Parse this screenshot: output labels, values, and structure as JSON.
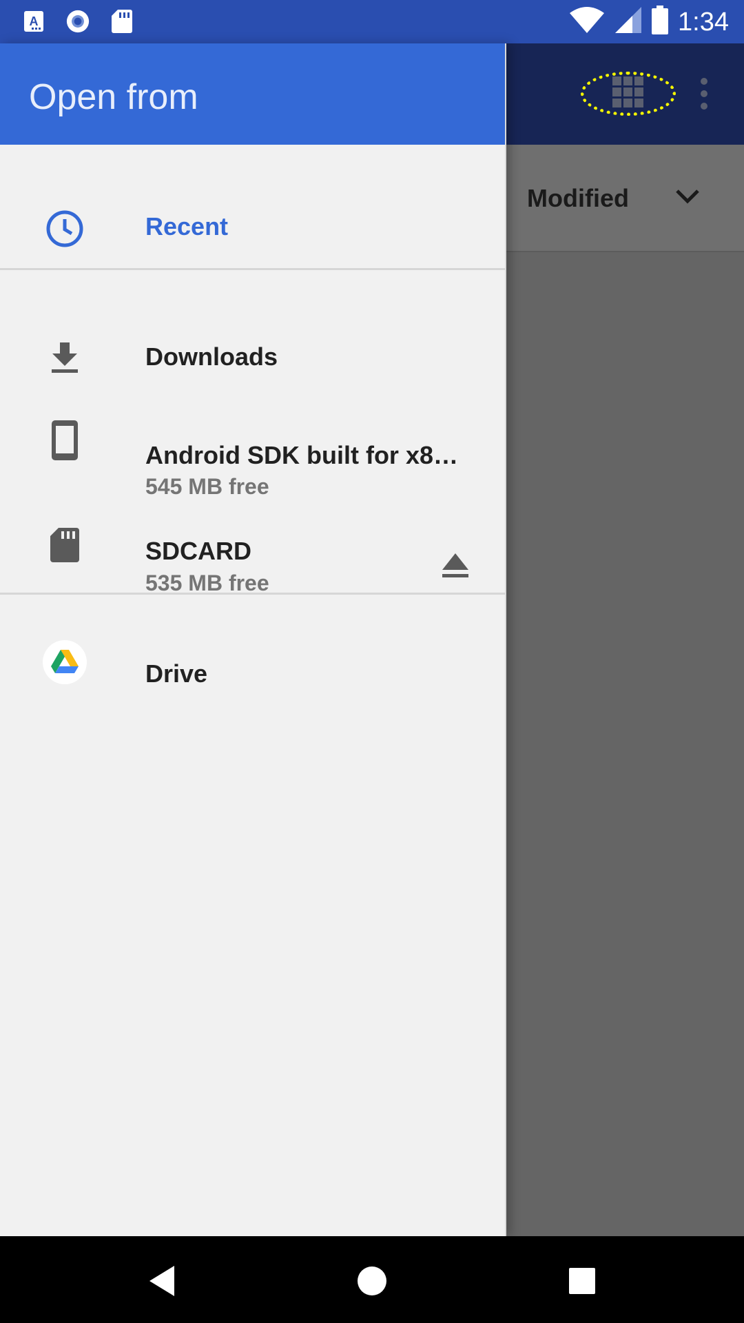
{
  "status_bar": {
    "time": "1:34",
    "icons": [
      "text-a-icon",
      "record-icon",
      "sd-card-icon",
      "wifi-icon",
      "signal-icon",
      "battery-icon"
    ]
  },
  "drawer": {
    "title": "Open from",
    "items": [
      {
        "label": "Recent",
        "icon": "clock-icon",
        "color": "#3469d6"
      },
      {
        "label": "Downloads",
        "icon": "download-icon"
      },
      {
        "label": "Android SDK built for x8…",
        "sub": "545 MB free",
        "icon": "phone-icon"
      },
      {
        "label": "SDCARD",
        "sub": "535 MB free",
        "icon": "sd-card-icon",
        "action_icon": "eject-icon"
      },
      {
        "label": "Drive",
        "icon": "drive-icon"
      }
    ]
  },
  "toolbar": {
    "view_toggle_icon": "grid-view-icon",
    "more_icon": "more-vert-icon"
  },
  "sort": {
    "label": "Modified"
  },
  "navigation": {
    "back": "back-icon",
    "home": "home-icon",
    "recents": "recents-icon"
  },
  "colors": {
    "status_bar": "#2a4eb0",
    "drawer_header": "#3469d6",
    "accent": "#3469d6",
    "highlight_ring": "#f4f500"
  }
}
